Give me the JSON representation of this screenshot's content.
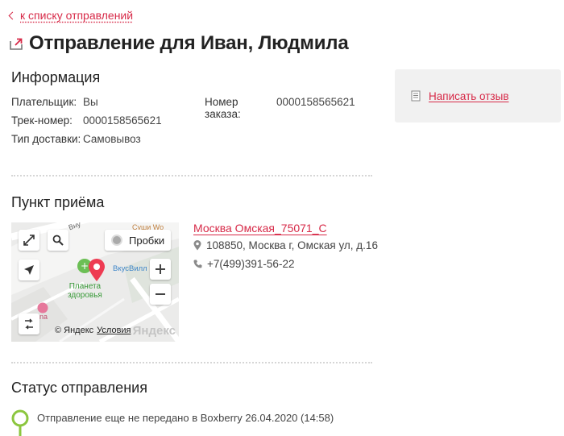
{
  "back_link": "к списку отправлений",
  "title": "Отправление для Иван, Людмила",
  "info": {
    "heading": "Информация",
    "payer_label": "Плательщик:",
    "payer_value": "Вы",
    "order_label": "Номер заказа:",
    "order_value": "0000158565621",
    "track_label": "Трек-номер:",
    "track_value": "0000158565621",
    "delivery_label": "Тип доставки:",
    "delivery_value": "Самовывоз"
  },
  "review": {
    "label": "Написать отзыв"
  },
  "pickup": {
    "heading": "Пункт приёма",
    "name": "Москва Омская_75071_С",
    "address": "108850, Москва г, Омская ул, д.16",
    "phone": "+7(499)391-56-22"
  },
  "map": {
    "traffic_label": "Пробки",
    "poi_pharmacy": "Планета\nздоровья",
    "poi_store": "ВкусВилл",
    "poi_food": "Суши Wo",
    "poi_other": "lena",
    "street": "Вну",
    "attribution": "© Яндекс",
    "terms": "Условия",
    "brand": "Яндекс"
  },
  "status": {
    "heading": "Статус отправления",
    "text": "Отправление еще не передано в Boxberry 26.04.2020 (14:58)"
  },
  "colors": {
    "accent": "#d72a48",
    "status_green": "#8cc63f",
    "panel_bg": "#f1f1f1"
  }
}
